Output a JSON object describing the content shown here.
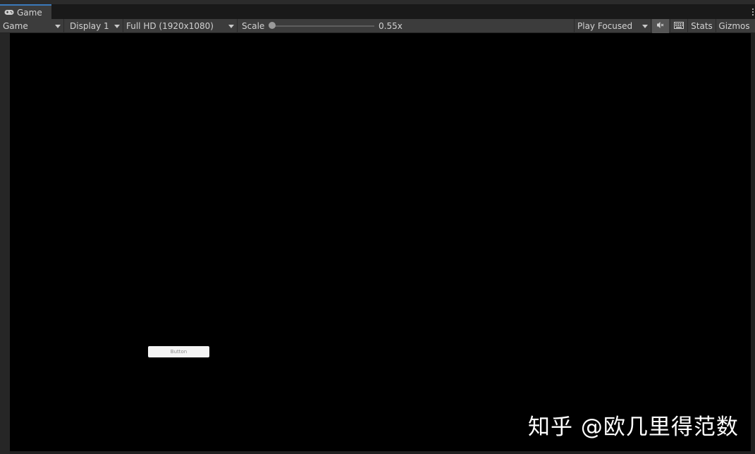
{
  "tab": {
    "label": "Game",
    "icon": "gamepad-icon"
  },
  "toolbar": {
    "view_select": "Game",
    "display_select": "Display 1",
    "resolution_select": "Full HD (1920x1080)",
    "scale_label": "Scale",
    "scale_value": "0.55x",
    "scale_fraction": 0.0,
    "play_mode_select": "Play Focused",
    "mute_icon": "mute-audio-icon",
    "keyboard_icon": "keyboard-shortcuts-icon",
    "stats_label": "Stats",
    "gizmos_label": "Gizmos"
  },
  "game": {
    "button_label": "Button"
  },
  "watermark": "知乎 @欧几里得范数"
}
